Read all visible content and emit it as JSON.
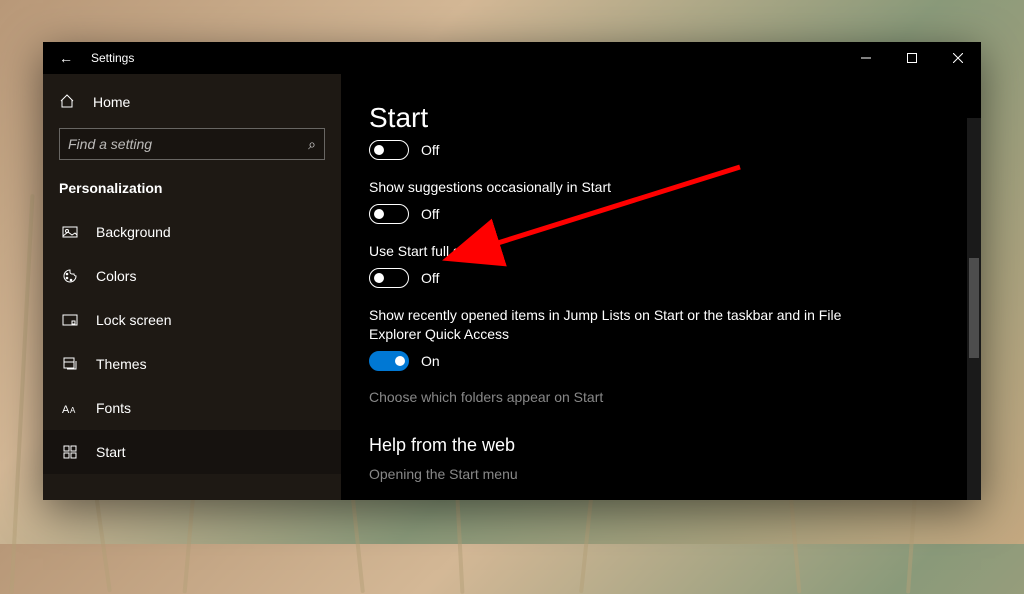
{
  "window": {
    "title": "Settings"
  },
  "sidebar": {
    "home_label": "Home",
    "search_placeholder": "Find a setting",
    "category": "Personalization",
    "items": [
      {
        "label": "Background"
      },
      {
        "label": "Colors"
      },
      {
        "label": "Lock screen"
      },
      {
        "label": "Themes"
      },
      {
        "label": "Fonts"
      },
      {
        "label": "Start"
      }
    ]
  },
  "page": {
    "title": "Start",
    "settings": [
      {
        "label": "",
        "state": "Off",
        "on": false
      },
      {
        "label": "Show suggestions occasionally in Start",
        "state": "Off",
        "on": false
      },
      {
        "label": "Use Start full screen",
        "state": "Off",
        "on": false
      },
      {
        "label": "Show recently opened items in Jump Lists on Start or the taskbar and in File Explorer Quick Access",
        "state": "On",
        "on": true
      }
    ],
    "folders_link": "Choose which folders appear on Start",
    "help_header": "Help from the web",
    "help_links": [
      "Opening the Start menu"
    ]
  },
  "annotation": {
    "color": "#ff0000"
  }
}
